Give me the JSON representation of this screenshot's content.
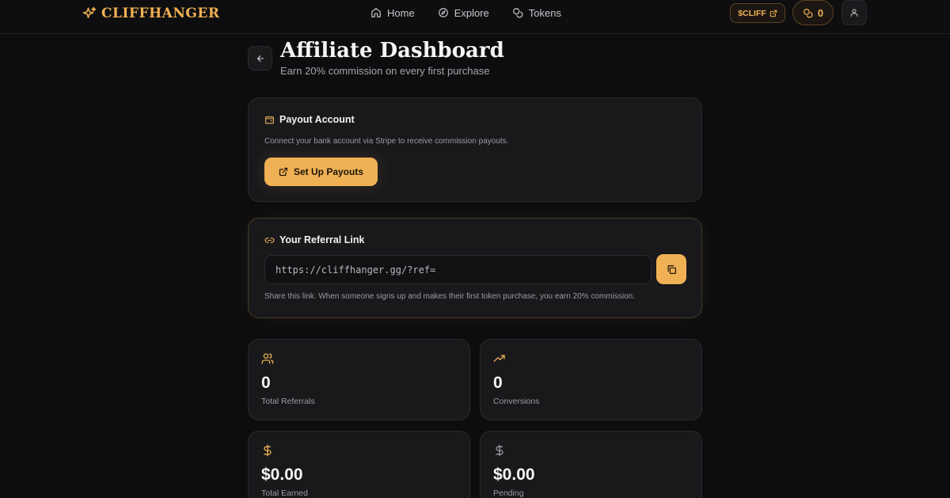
{
  "brand": {
    "name": "CLIFFHANGER",
    "accent": "#efb154"
  },
  "nav": {
    "items": [
      {
        "label": "Home",
        "icon": "home-icon"
      },
      {
        "label": "Explore",
        "icon": "compass-icon"
      },
      {
        "label": "Tokens",
        "icon": "coins-icon"
      }
    ],
    "cliff_label": "$CLIFF",
    "token_balance": "0"
  },
  "header": {
    "title": "Affiliate Dashboard",
    "subtitle": "Earn 20% commission on every first purchase"
  },
  "payout": {
    "title": "Payout Account",
    "description": "Connect your bank account via Stripe to receive commission payouts.",
    "button_label": "Set Up Payouts"
  },
  "referral": {
    "title": "Your Referral Link",
    "link": "https://cliffhanger.gg/?ref=",
    "note": "Share this link. When someone signs up and makes their first token purchase, you earn 20% commission."
  },
  "stats": [
    {
      "value": "0",
      "label": "Total Referrals",
      "icon": "users-icon",
      "icon_color": "#efb154"
    },
    {
      "value": "0",
      "label": "Conversions",
      "icon": "trending-up-icon",
      "icon_color": "#efb154"
    },
    {
      "value": "$0.00",
      "label": "Total Earned",
      "icon": "dollar-icon",
      "icon_color": "#efb154"
    },
    {
      "value": "$0.00",
      "label": "Pending",
      "icon": "dollar-icon",
      "icon_color": "#9b9ba1"
    }
  ]
}
